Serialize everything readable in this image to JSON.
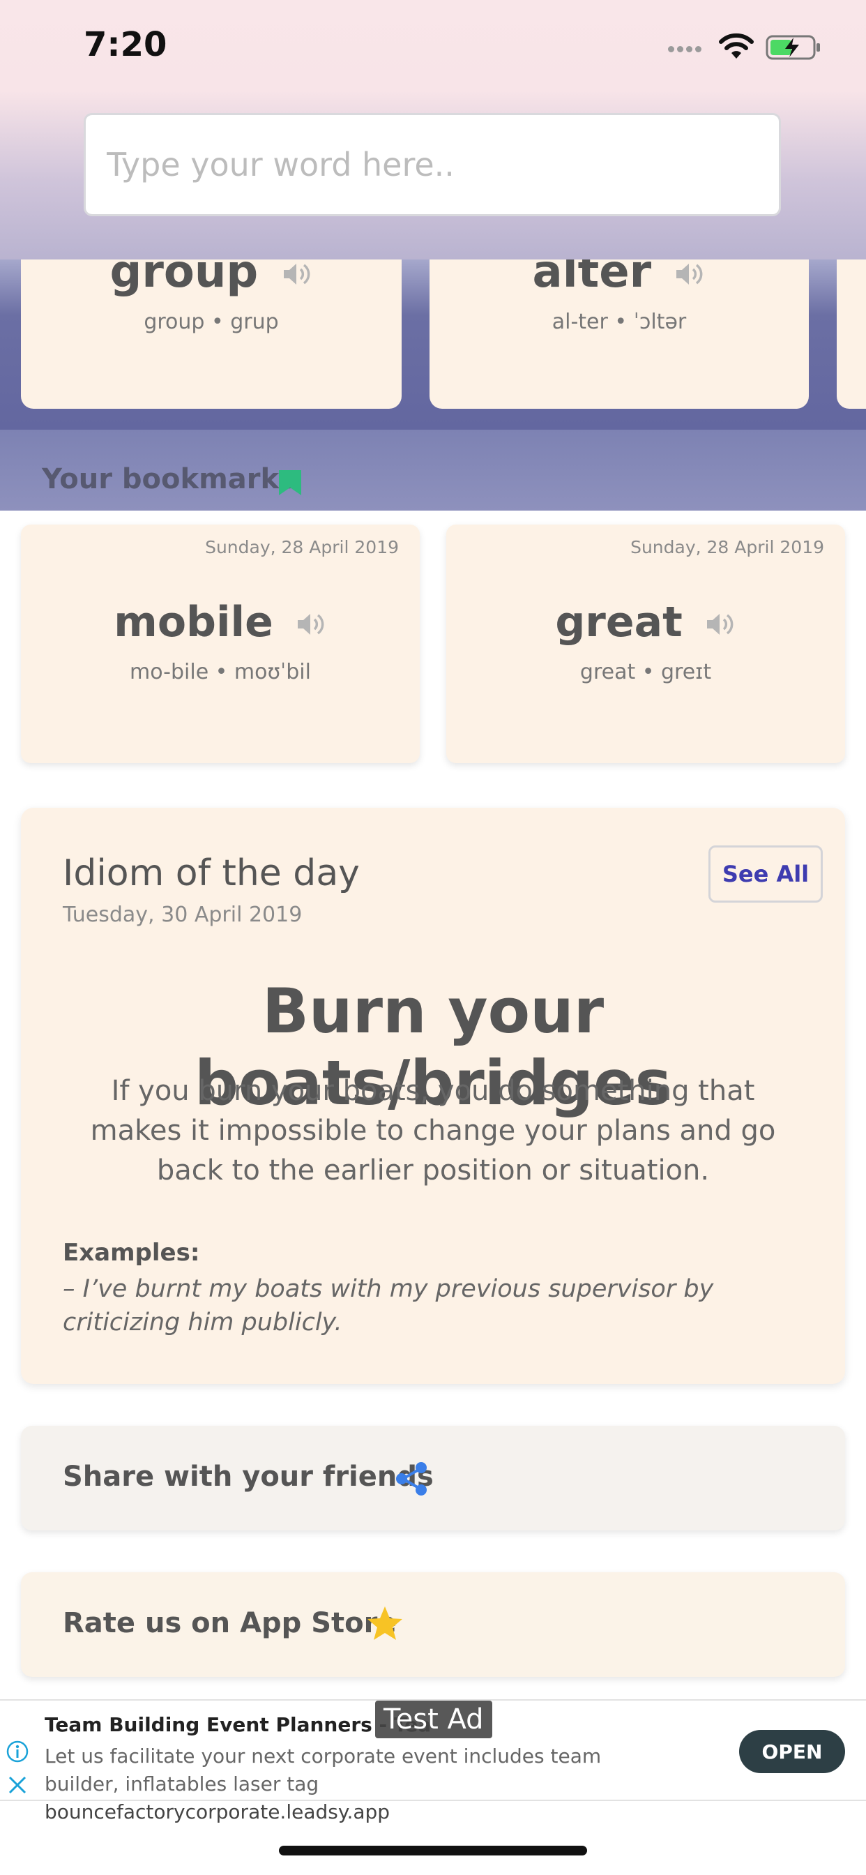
{
  "status_bar": {
    "time": "7:20"
  },
  "search": {
    "placeholder": "Type your word here.."
  },
  "recent_words": [
    {
      "word": "group",
      "phonetic": "group • grup"
    },
    {
      "word": "alter",
      "phonetic": "al-ter • ˈɔltər"
    }
  ],
  "bookmarks": {
    "label": "Your bookmarks",
    "items": [
      {
        "date": "Sunday, 28 April 2019",
        "word": "mobile",
        "phonetic": "mo-bile • moʊˈbil"
      },
      {
        "date": "Sunday, 28 April 2019",
        "word": "great",
        "phonetic": "great • greɪt"
      }
    ]
  },
  "idiom": {
    "heading": "Idiom of the day",
    "date": "Tuesday, 30 April 2019",
    "see_all": "See All",
    "title": "Burn your boats/bridges",
    "meaning": "If you burn your boats, you do something that makes it impossible to change your plans and go back to the earlier position or situation.",
    "examples_label": "Examples:",
    "examples_text": "– I’ve burnt my boats with my previous supervisor by criticizing him publicly."
  },
  "share": {
    "label": "Share with your friends"
  },
  "rate": {
    "label": "Rate us on App Store"
  },
  "ad": {
    "title": "Team Building Event Planners - Tea",
    "badge": "Test Ad",
    "body": "Let us facilitate your next corporate event includes team builder, inflatables laser tag ",
    "domain": "bouncefactorycorporate.leadsy.app",
    "open_label": "OPEN"
  },
  "colors": {
    "accent": "#3e3cb0",
    "bookmark_green": "#2dbb7f",
    "share_blue": "#3a7ee8",
    "star_yellow": "#f7c325",
    "card_bg": "#fdf2e6"
  },
  "icons": [
    "wifi-icon",
    "battery-icon",
    "speaker-icon",
    "bookmark-icon",
    "share-icon",
    "star-icon",
    "info-icon",
    "close-icon"
  ]
}
